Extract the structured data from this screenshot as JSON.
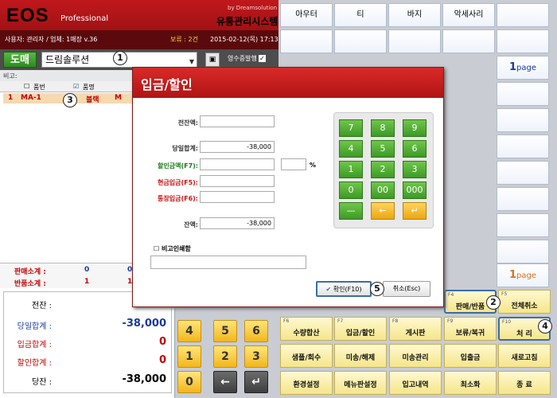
{
  "header": {
    "logo": "EOS",
    "product": "Professional",
    "by": "by Dreamsolution",
    "system": "유통관리시스템",
    "user": "사용자: 관리자 / 업체: 1매장 v.36",
    "hold": "보류 : 2건",
    "datetime": "2015-02-12(목) 17:13"
  },
  "customer_row": {
    "sale_type": "도매",
    "customer": "드림솔루션",
    "receipt_label": "영수증발행",
    "receipt_check": "✓"
  },
  "list": {
    "memo_label": "비고:",
    "col_code": "품번",
    "col_name": "품명",
    "row": {
      "num": "1",
      "code": "MA-1",
      "color": "블랙",
      "size": "M"
    }
  },
  "counts": {
    "sale_label": "판매소계 :",
    "sale_a": "0",
    "sale_b": "0",
    "return_label": "반품소계 :",
    "return_a": "1",
    "return_b": "1"
  },
  "summary": [
    {
      "label": "전잔 :",
      "value": ""
    },
    {
      "label": "당일합계 :",
      "value": "-38,000"
    },
    {
      "label": "입금합계 :",
      "value": "0"
    },
    {
      "label": "할인합계 :",
      "value": "0"
    },
    {
      "label": "당잔 :",
      "value": "-38,000"
    }
  ],
  "grid": {
    "top": [
      "아우터",
      "티",
      "바지",
      "악세사리"
    ],
    "page_top": "page",
    "page_top_num": "1",
    "page_bottom": "page",
    "page_bottom_num": "1"
  },
  "keypad": {
    "k4": "4",
    "k5": "5",
    "k6": "6",
    "k1": "1",
    "k2": "2",
    "k3": "3",
    "k0": "0",
    "back": "←",
    "enter": "↵"
  },
  "fkeys": [
    {
      "key": "F4",
      "label": "판매/반품"
    },
    {
      "key": "F5",
      "label": "전체취소"
    },
    {
      "key": "F6",
      "label": "수량합산"
    },
    {
      "key": "F7",
      "label": "입금/할인"
    },
    {
      "key": "F8",
      "label": "게시판"
    },
    {
      "key": "F9",
      "label": "보류/복귀"
    },
    {
      "key": "F10",
      "label": "처 리"
    },
    {
      "key": "",
      "label": "샘플/회수"
    },
    {
      "key": "",
      "label": "미송/해제"
    },
    {
      "key": "",
      "label": "미송관리"
    },
    {
      "key": "",
      "label": "입출금"
    },
    {
      "key": "",
      "label": "새로고침"
    },
    {
      "key": "",
      "label": "환경설정"
    },
    {
      "key": "",
      "label": "메뉴판설정"
    },
    {
      "key": "",
      "label": "입고내역"
    },
    {
      "key": "",
      "label": "최소화"
    },
    {
      "key": "",
      "label": "종 료"
    }
  ],
  "dialog": {
    "title": "입금/할인",
    "prev_balance": "전잔액:",
    "day_total": "당일합계:",
    "day_total_val": "-38,000",
    "discount": "할인금액(F7):",
    "cash": "현금입금(F5):",
    "bank": "통장입금(F6):",
    "balance": "잔액:",
    "balance_val": "-38,000",
    "pct": "%",
    "print_memo": "비고인쇄함",
    "ok": "확인(F10)",
    "cancel": "취소(Esc)",
    "numpad": [
      "7",
      "8",
      "9",
      "4",
      "5",
      "6",
      "1",
      "2",
      "3",
      "0",
      "00",
      "000",
      "—",
      "←",
      "↵"
    ]
  },
  "callouts": [
    "1",
    "2",
    "3",
    "4",
    "5"
  ]
}
